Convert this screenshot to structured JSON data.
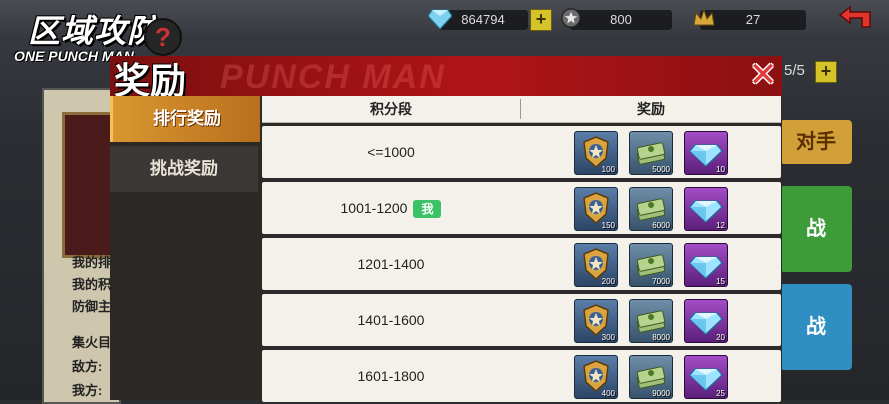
{
  "header": {
    "logo_main": "区域攻防",
    "logo_sub": "ONE PUNCH MAN",
    "help_symbol": "?",
    "diamonds": "864794",
    "badges": "800",
    "crowns": "27",
    "plus_label": "+"
  },
  "background": {
    "left_lines": [
      "我的排",
      "我的积",
      "防御主",
      "集火目",
      "敌方:",
      "我方:"
    ],
    "right_buttons": [
      "对手",
      "战",
      "战"
    ],
    "count": "5/5"
  },
  "modal": {
    "title": "奖励",
    "watermark": "PUNCH MAN",
    "close_symbol": "✕",
    "tabs": [
      {
        "label": "排行奖励",
        "active": true
      },
      {
        "label": "挑战奖励",
        "active": false
      }
    ],
    "columns": {
      "range": "积分段",
      "reward": "奖励"
    },
    "me_label": "我",
    "rows": [
      {
        "range": "<=1000",
        "is_me": false,
        "rewards": [
          "100",
          "5000",
          "10"
        ]
      },
      {
        "range": "1001-1200",
        "is_me": true,
        "rewards": [
          "150",
          "6000",
          "12"
        ]
      },
      {
        "range": "1201-1400",
        "is_me": false,
        "rewards": [
          "200",
          "7000",
          "15"
        ]
      },
      {
        "range": "1401-1600",
        "is_me": false,
        "rewards": [
          "300",
          "8000",
          "20"
        ]
      },
      {
        "range": "1601-1800",
        "is_me": false,
        "rewards": [
          "400",
          "9000",
          "25"
        ]
      }
    ]
  },
  "icons": {
    "diamond": "diamond-icon",
    "badge": "shield-badge-icon",
    "crown": "crown-icon",
    "back": "back-arrow-icon",
    "close": "close-icon",
    "cash": "cash-stack-icon",
    "gem": "gem-icon"
  },
  "colors": {
    "header_red": "#b11416",
    "tab_active": "#d9962f",
    "me_badge": "#3bc267",
    "gem_purple": "#a34dc6"
  }
}
